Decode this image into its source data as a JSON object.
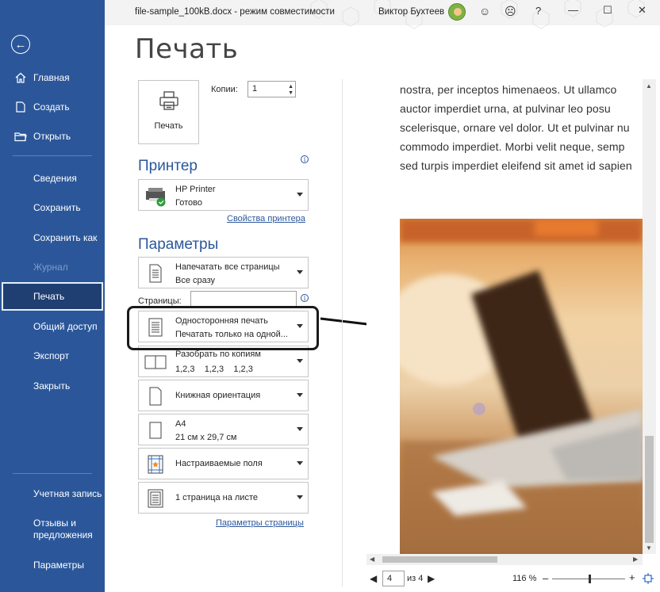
{
  "window": {
    "title": "file-sample_100kB.docx  -  режим совместимости",
    "user_name": "Виктор Бухтеев",
    "controls": [
      "smiley-icon",
      "frown-icon",
      "help-icon",
      "minimize-icon",
      "maximize-icon",
      "close-icon"
    ]
  },
  "sidebar": {
    "top_items": [
      {
        "label": "Главная",
        "icon": "home-icon"
      },
      {
        "label": "Создать",
        "icon": "new-doc-icon"
      },
      {
        "label": "Открыть",
        "icon": "folder-icon"
      }
    ],
    "middle_items": [
      {
        "label": "Сведения"
      },
      {
        "label": "Сохранить"
      },
      {
        "label": "Сохранить как"
      },
      {
        "label": "Журнал",
        "disabled": true
      },
      {
        "label": "Печать",
        "selected": true
      },
      {
        "label": "Общий доступ"
      },
      {
        "label": "Экспорт"
      },
      {
        "label": "Закрыть"
      }
    ],
    "bottom_items": [
      {
        "label": "Учетная запись"
      },
      {
        "label": "Отзывы и\nпредложения"
      },
      {
        "label": "Параметры"
      }
    ]
  },
  "page": {
    "title": "Печать",
    "print_button_label": "Печать",
    "copies_label": "Копии:",
    "copies_value": "1"
  },
  "printer": {
    "heading": "Принтер",
    "name": "HP Printer",
    "status": "Готово",
    "properties_link": "Свойства принтера"
  },
  "settings": {
    "heading": "Параметры",
    "pages_label": "Страницы:",
    "pages_value": "",
    "dropdowns": [
      {
        "line1": "Напечатать все страницы",
        "line2": "Все сразу",
        "icon": "pages-icon"
      },
      {
        "line1": "Односторонняя печать",
        "line2": "Печатать только на одной...",
        "icon": "one-sided-icon"
      },
      {
        "line1": "Разобрать по копиям",
        "line2": "1,2,3    1,2,3    1,2,3",
        "icon": "collate-icon"
      },
      {
        "line1": "Книжная ориентация",
        "icon": "portrait-icon"
      },
      {
        "line1": "A4",
        "line2": "21 см x 29,7 см",
        "icon": "paper-size-icon"
      },
      {
        "line1": "Настраиваемые поля",
        "icon": "margins-icon"
      },
      {
        "line1": "1 страница на листе",
        "icon": "pages-per-sheet-icon"
      }
    ],
    "page_setup_link": "Параметры страницы"
  },
  "preview": {
    "text_lines": [
      "nostra, per inceptos himenaeos. Ut ullamco",
      "auctor imperdiet urna, at pulvinar leo posu",
      "scelerisque, ornare vel dolor. Ut et pulvinar nu",
      "commodo imperdiet. Morbi velit neque, semp",
      "sed turpis imperdiet eleifend sit amet id sapien"
    ],
    "current_page": "4",
    "of_pages": "из 4",
    "zoom": "116 %"
  }
}
